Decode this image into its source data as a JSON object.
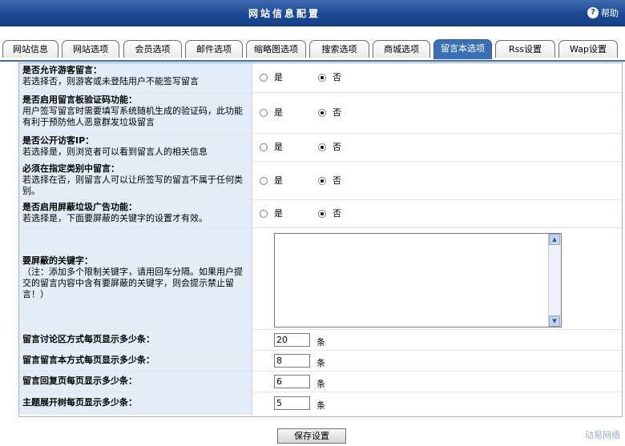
{
  "header": {
    "title": "网站信息配置",
    "help_label": "帮助",
    "help_icon": "question-circle-icon"
  },
  "tabs": [
    {
      "label": "网站信息"
    },
    {
      "label": "网站选项"
    },
    {
      "label": "会员选项"
    },
    {
      "label": "邮件选项"
    },
    {
      "label": "缩略图选项"
    },
    {
      "label": "搜索选项"
    },
    {
      "label": "商城选项"
    },
    {
      "label": "留言本选项",
      "active": true
    },
    {
      "label": "Rss设置"
    },
    {
      "label": "Wap设置"
    }
  ],
  "settings": {
    "guest_post": {
      "title": "是否允许游客留言：",
      "desc": "若选择否，则游客或未登陆用户不能签写留言",
      "yes": "是",
      "no": "否",
      "selected": "no"
    },
    "captcha": {
      "title": "是否启用留言板验证码功能：",
      "desc": "用户签写留言时需要填写系统随机生成的验证码，此功能有利于预防他人恶意群发垃圾留言",
      "yes": "是",
      "no": "否",
      "selected": "no"
    },
    "show_ip": {
      "title": "是否公开访客IP：",
      "desc": "若选择是，则浏览者可以看到留言人的相关信息",
      "yes": "是",
      "no": "否",
      "selected": "no"
    },
    "require_category": {
      "title": "必须在指定类别中留言：",
      "desc": "若选择在否，则留言人可以让所签写的留言不属于任何类别。",
      "yes": "是",
      "no": "否",
      "selected": "no"
    },
    "spam_filter": {
      "title": "是否启用屏蔽垃圾广告功能：",
      "desc": "若选择是，下面要屏蔽的关键字的设置才有效。",
      "yes": "是",
      "no": "否",
      "selected": "no"
    },
    "keywords": {
      "title": "要屏蔽的关键字：",
      "desc": "（注：添加多个限制关键字，请用回车分隔。如果用户提交的留言内容中含有要屏蔽的关键字，则会提示禁止留言！）",
      "value": ""
    },
    "per_page_forum": {
      "title": "留言讨论区方式每页显示多少条：",
      "value": "20",
      "unit": "条"
    },
    "per_page_book": {
      "title": "留言留言本方式每页显示多少条：",
      "value": "8",
      "unit": "条"
    },
    "per_page_reply": {
      "title": "留言回复页每页显示多少条：",
      "value": "6",
      "unit": "条"
    },
    "per_page_topic": {
      "title": "主题展开树每页显示多少条：",
      "value": "5",
      "unit": "条"
    }
  },
  "footer": {
    "save_label": "保存设置",
    "watermark": "动易网络"
  }
}
